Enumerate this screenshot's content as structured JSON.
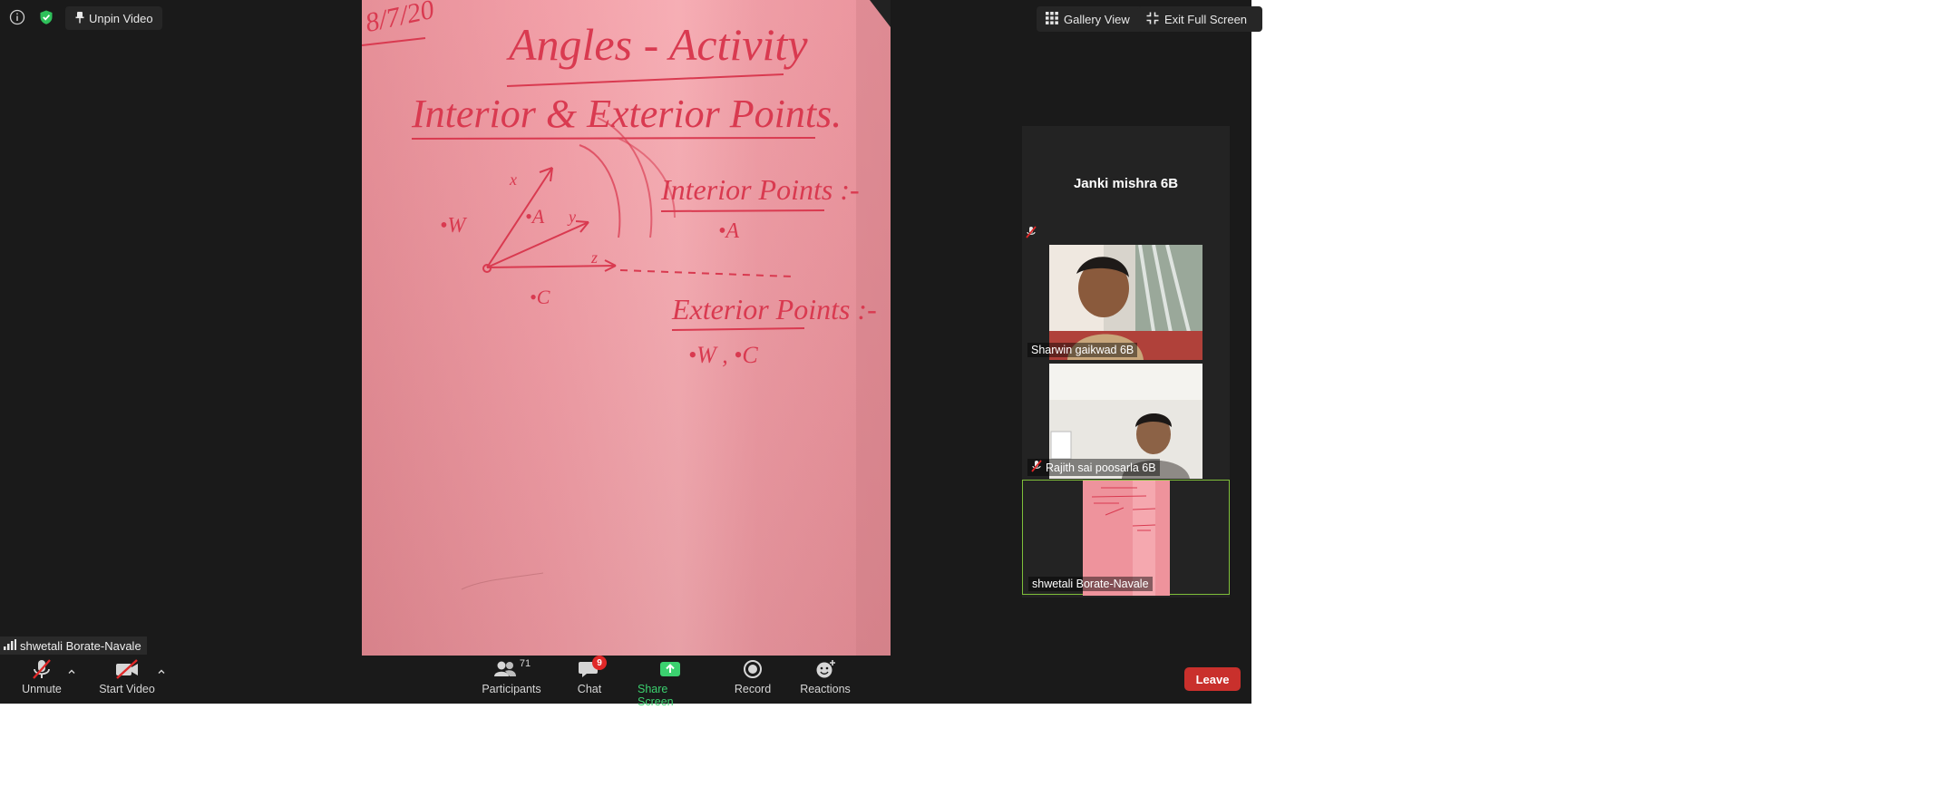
{
  "top_left": {
    "unpin_label": "Unpin Video",
    "info_icon": "info-icon",
    "security_icon": "shield-check-icon"
  },
  "top_right": {
    "gallery_label": "Gallery View",
    "exit_fullscreen_label": "Exit Full Screen"
  },
  "whiteboard": {
    "date": "8/7/20",
    "title": "Angles - Activity",
    "subtitle": "Interior & Exterior Points.",
    "interior_heading": "Interior Points :-",
    "interior_points": "•A",
    "exterior_heading": "Exterior Points :-",
    "exterior_points": "•W , •C",
    "point_w": "•W",
    "point_a": "•A",
    "point_c": "•C",
    "label_x": "x",
    "label_y": "y",
    "label_z": "z",
    "label_o": "O"
  },
  "participants": [
    {
      "name": "Janki mishra 6B",
      "muted": true,
      "video": false
    },
    {
      "name": "Sharwin gaikwad 6B",
      "muted": false,
      "video": true
    },
    {
      "name": "Rajith sai poosarla 6B",
      "muted": true,
      "video": true
    },
    {
      "name": "shwetali Borate-Navale",
      "muted": false,
      "video": true,
      "active": true
    }
  ],
  "active_speaker": "shwetali Borate-Navale",
  "toolbar": {
    "unmute_label": "Unmute",
    "start_video_label": "Start Video",
    "participants_label": "Participants",
    "participants_count": "71",
    "chat_label": "Chat",
    "chat_badge": "9",
    "share_label": "Share Screen",
    "record_label": "Record",
    "reactions_label": "Reactions",
    "leave_label": "Leave"
  },
  "colors": {
    "share_green": "#3bd16f",
    "leave_red": "#c9302c",
    "active_border": "#7fbf3a",
    "ink": "#d93a50"
  }
}
